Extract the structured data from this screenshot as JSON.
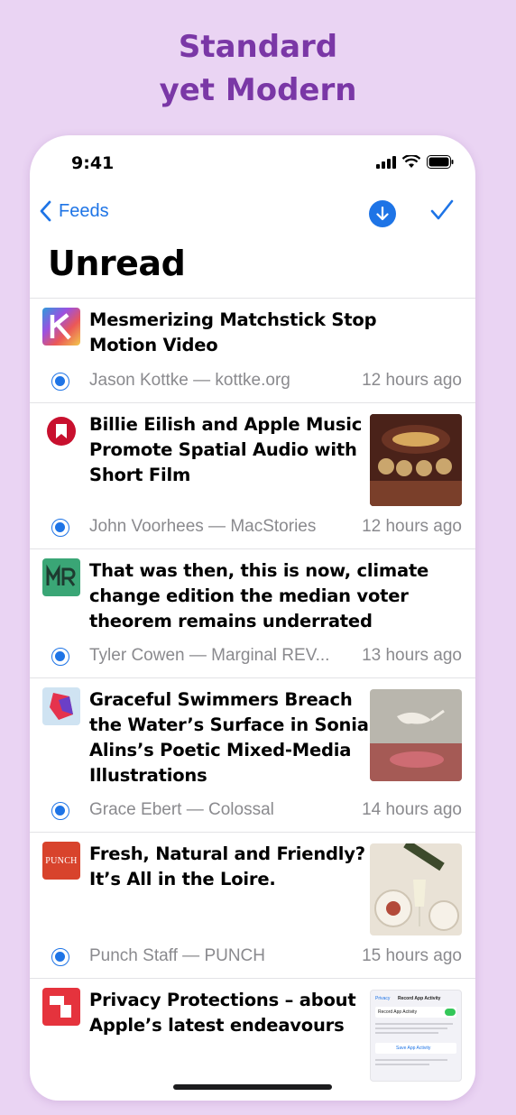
{
  "promo": {
    "line1": "Standard",
    "line2": "yet Modern"
  },
  "status_bar": {
    "time": "9:41"
  },
  "nav": {
    "back_label": "Feeds",
    "accent_color": "#1e74e6"
  },
  "page": {
    "title": "Unread"
  },
  "articles": [
    {
      "title_lines": [
        "Mesmerizing Matchstick Stop",
        "Motion Video"
      ],
      "author": "Jason Kottke — kottke.org",
      "time": "12 hours ago",
      "source_icon": "kottke-icon",
      "has_thumbnail": false
    },
    {
      "title_lines": [
        "Billie Eilish and Apple Music",
        "Promote Spatial Audio with",
        "Short Film"
      ],
      "author": "John Voorhees — MacStories",
      "time": "12 hours ago",
      "source_icon": "macstories-icon",
      "has_thumbnail": true
    },
    {
      "title_lines": [
        "That was then, this is now, climate",
        "change edition the median voter",
        "theorem remains underrated"
      ],
      "author": "Tyler Cowen — Marginal REV...",
      "time": "13 hours ago",
      "source_icon": "marginal-revolution-icon",
      "has_thumbnail": false
    },
    {
      "title_lines": [
        "Graceful Swimmers Breach",
        "the Water’s Surface in Sonia",
        "Alins’s Poetic Mixed-Media",
        "Illustrations"
      ],
      "author": "Grace Ebert — Colossal",
      "time": "14 hours ago",
      "source_icon": "colossal-icon",
      "has_thumbnail": true
    },
    {
      "title_lines": [
        "Fresh, Natural and Friendly?",
        "It’s All in the Loire."
      ],
      "author": "Punch Staff — PUNCH",
      "time": "15 hours ago",
      "source_icon": "punch-icon",
      "source_icon_text": "PUNCH",
      "has_thumbnail": true
    },
    {
      "title_lines": [
        "Privacy Protections – about",
        "Apple’s latest endeavours"
      ],
      "source_icon": "techsound-icon",
      "has_thumbnail": true
    }
  ],
  "thumbnail_privacy": {
    "back": "Privacy",
    "title": "Record App Activity",
    "row": "Record App Activity",
    "button": "Save App Activity"
  }
}
